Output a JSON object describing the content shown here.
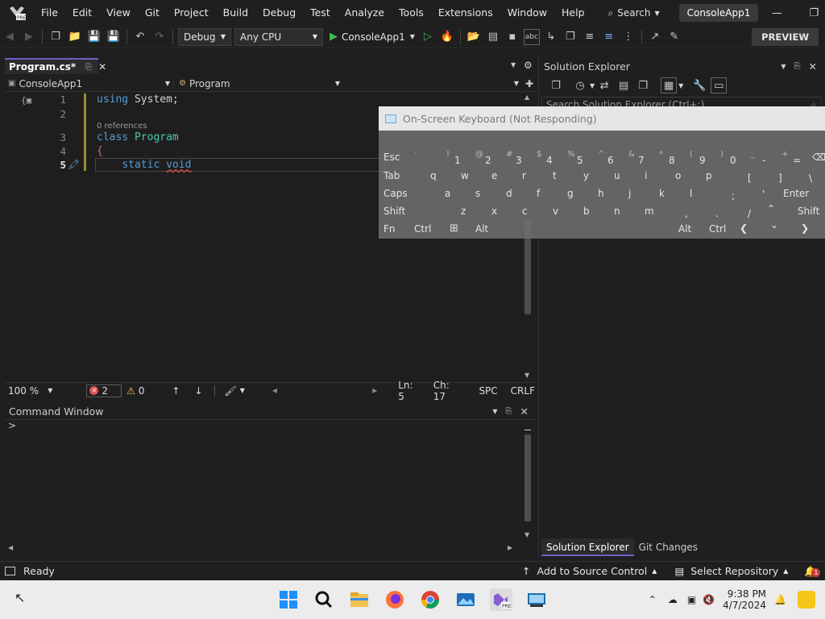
{
  "menubar": {
    "items": [
      "File",
      "Edit",
      "View",
      "Git",
      "Project",
      "Build",
      "Debug",
      "Test",
      "Analyze",
      "Tools",
      "Extensions",
      "Window",
      "Help"
    ],
    "search_label": "Search",
    "app_name": "ConsoleApp1",
    "logo_text": "PRE"
  },
  "toolbar": {
    "config": "Debug",
    "platform": "Any CPU",
    "run_target": "ConsoleApp1",
    "preview_label": "PREVIEW"
  },
  "editor": {
    "tab_name": "Program.cs*",
    "nav_project": "ConsoleApp1",
    "nav_class": "Program",
    "lines": [
      {
        "n": "1",
        "text": "using System;"
      },
      {
        "n": "2",
        "text": ""
      },
      {
        "n": "3",
        "text": "class Program"
      },
      {
        "n": "4",
        "text": "{"
      },
      {
        "n": "5",
        "text": "    static void"
      }
    ],
    "code_using": "using",
    "code_system": "System;",
    "code_class": "class",
    "code_program": "Program",
    "code_brace": "{",
    "code_static": "static",
    "code_void": "void",
    "references": "0 references",
    "zoom": "100 %",
    "errors": "2",
    "warnings": "0",
    "line_pos": "Ln: 5",
    "char_pos": "Ch: 17",
    "whitespace": "SPC",
    "line_ending": "CRLF"
  },
  "command_window": {
    "title": "Command Window",
    "prompt": ">"
  },
  "solution_explorer": {
    "title": "Solution Explorer",
    "search_placeholder": "Search Solution Explorer (Ctrl+;)",
    "tabs": [
      "Solution Explorer",
      "Git Changes"
    ]
  },
  "osk": {
    "title": "On-Screen Keyboard (Not Responding)",
    "row1": [
      "Esc",
      "1",
      "2",
      "3",
      "4",
      "5",
      "6",
      "7",
      "8",
      "9",
      "0",
      "-",
      "="
    ],
    "row2": [
      "Tab",
      "q",
      "w",
      "e",
      "r",
      "t",
      "y",
      "u",
      "i",
      "o",
      "p",
      "[",
      "]",
      "\\"
    ],
    "row3": [
      "Caps",
      "a",
      "s",
      "d",
      "f",
      "g",
      "h",
      "j",
      "k",
      "l",
      ";",
      "'",
      "Enter"
    ],
    "row4": [
      "Shift",
      "z",
      "x",
      "c",
      "v",
      "b",
      "n",
      "m",
      ",",
      ".",
      "/",
      "Shift"
    ],
    "row5": [
      "Fn",
      "Ctrl",
      "Alt",
      "Alt",
      "Ctrl"
    ],
    "shift_row1": [
      "`",
      "!",
      "@",
      "#",
      "$",
      "%",
      "^",
      "&",
      "*",
      "(",
      ")",
      "_",
      "+"
    ]
  },
  "statusbar": {
    "ready": "Ready",
    "source_control": "Add to Source Control",
    "repo": "Select Repository",
    "notifications": "1"
  },
  "taskbar": {
    "time": "9:38 PM",
    "date": "4/7/2024"
  }
}
